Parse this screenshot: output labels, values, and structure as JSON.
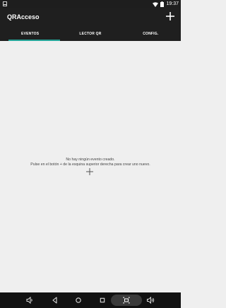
{
  "status_bar": {
    "time": "19:37"
  },
  "app_bar": {
    "title": "QRAcceso"
  },
  "tabs": [
    {
      "label": "EVENTOS"
    },
    {
      "label": "LECTOR QR"
    },
    {
      "label": "CONFIG."
    }
  ],
  "empty_state": {
    "line1": "No hay ningún evento creado.",
    "line2": "Pulse en el botón + de la esquina superior derecha para crear uno nuevo."
  },
  "colors": {
    "accent": "#26a69a",
    "toolbar": "#1f1f1f",
    "background": "#efefef"
  }
}
